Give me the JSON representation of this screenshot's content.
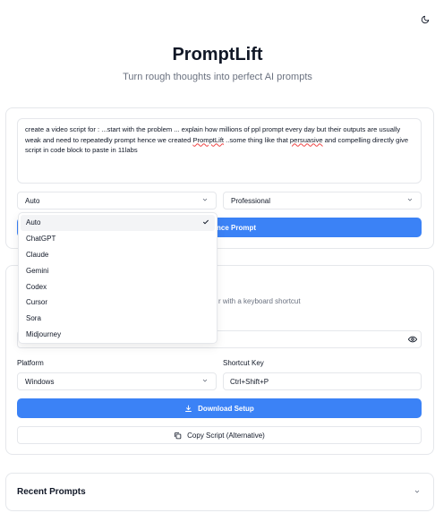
{
  "header": {
    "title": "PromptLift",
    "subtitle": "Turn rough thoughts into perfect AI prompts",
    "theme_icon": "moon-icon"
  },
  "prompt": {
    "text_part1": "create a video script for : ...start with the problem ... explain how millions of ppl prompt every day but their outputs are usually weak and need to repeatedly prompt hence we created ",
    "misspelled1": "PromptLift",
    "text_part2": " ..some thing like that ",
    "misspelled2": "persuasive",
    "text_part3": " and compelling directly give script in code block to paste in 11labs"
  },
  "model_select": {
    "value": "Auto",
    "options": [
      "Auto",
      "ChatGPT",
      "Claude",
      "Gemini",
      "Codex",
      "Cursor",
      "Sora",
      "Midjourney"
    ],
    "selected_index": 0
  },
  "tone_select": {
    "value": "Professional"
  },
  "enhance_button": {
    "label": "nce Prompt"
  },
  "setup": {
    "description": "r with a keyboard shortcut",
    "platform_label": "Platform",
    "platform_value": "Windows",
    "shortcut_label": "Shortcut Key",
    "shortcut_value": "Ctrl+Shift+P",
    "download_label": "Download Setup",
    "copy_label": "Copy Script (Alternative)"
  },
  "recent": {
    "title": "Recent Prompts"
  },
  "colors": {
    "accent": "#3b82f6",
    "border": "#e5e7eb",
    "muted_text": "#6b7280"
  }
}
